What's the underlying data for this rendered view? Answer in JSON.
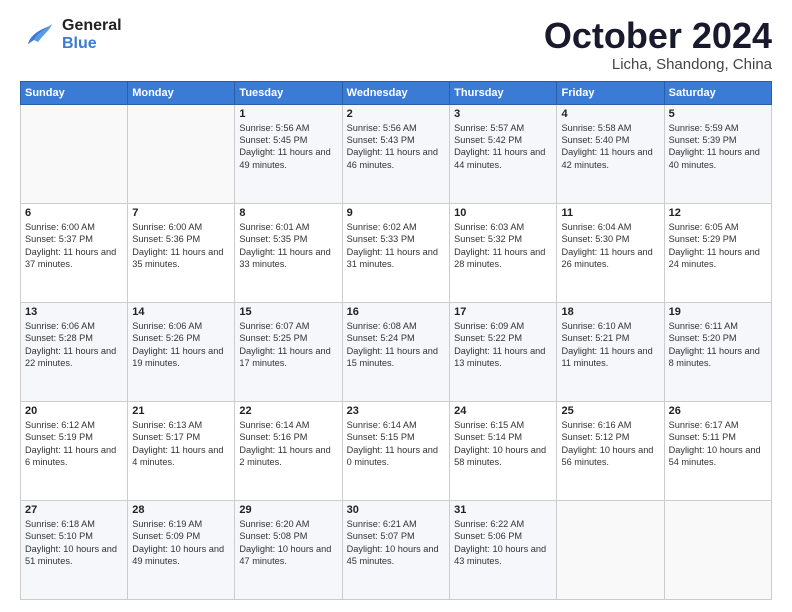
{
  "header": {
    "logo_general": "General",
    "logo_blue": "Blue",
    "month": "October 2024",
    "location": "Licha, Shandong, China"
  },
  "days_of_week": [
    "Sunday",
    "Monday",
    "Tuesday",
    "Wednesday",
    "Thursday",
    "Friday",
    "Saturday"
  ],
  "weeks": [
    [
      {
        "day": "",
        "info": ""
      },
      {
        "day": "",
        "info": ""
      },
      {
        "day": "1",
        "info": "Sunrise: 5:56 AM\nSunset: 5:45 PM\nDaylight: 11 hours and 49 minutes."
      },
      {
        "day": "2",
        "info": "Sunrise: 5:56 AM\nSunset: 5:43 PM\nDaylight: 11 hours and 46 minutes."
      },
      {
        "day": "3",
        "info": "Sunrise: 5:57 AM\nSunset: 5:42 PM\nDaylight: 11 hours and 44 minutes."
      },
      {
        "day": "4",
        "info": "Sunrise: 5:58 AM\nSunset: 5:40 PM\nDaylight: 11 hours and 42 minutes."
      },
      {
        "day": "5",
        "info": "Sunrise: 5:59 AM\nSunset: 5:39 PM\nDaylight: 11 hours and 40 minutes."
      }
    ],
    [
      {
        "day": "6",
        "info": "Sunrise: 6:00 AM\nSunset: 5:37 PM\nDaylight: 11 hours and 37 minutes."
      },
      {
        "day": "7",
        "info": "Sunrise: 6:00 AM\nSunset: 5:36 PM\nDaylight: 11 hours and 35 minutes."
      },
      {
        "day": "8",
        "info": "Sunrise: 6:01 AM\nSunset: 5:35 PM\nDaylight: 11 hours and 33 minutes."
      },
      {
        "day": "9",
        "info": "Sunrise: 6:02 AM\nSunset: 5:33 PM\nDaylight: 11 hours and 31 minutes."
      },
      {
        "day": "10",
        "info": "Sunrise: 6:03 AM\nSunset: 5:32 PM\nDaylight: 11 hours and 28 minutes."
      },
      {
        "day": "11",
        "info": "Sunrise: 6:04 AM\nSunset: 5:30 PM\nDaylight: 11 hours and 26 minutes."
      },
      {
        "day": "12",
        "info": "Sunrise: 6:05 AM\nSunset: 5:29 PM\nDaylight: 11 hours and 24 minutes."
      }
    ],
    [
      {
        "day": "13",
        "info": "Sunrise: 6:06 AM\nSunset: 5:28 PM\nDaylight: 11 hours and 22 minutes."
      },
      {
        "day": "14",
        "info": "Sunrise: 6:06 AM\nSunset: 5:26 PM\nDaylight: 11 hours and 19 minutes."
      },
      {
        "day": "15",
        "info": "Sunrise: 6:07 AM\nSunset: 5:25 PM\nDaylight: 11 hours and 17 minutes."
      },
      {
        "day": "16",
        "info": "Sunrise: 6:08 AM\nSunset: 5:24 PM\nDaylight: 11 hours and 15 minutes."
      },
      {
        "day": "17",
        "info": "Sunrise: 6:09 AM\nSunset: 5:22 PM\nDaylight: 11 hours and 13 minutes."
      },
      {
        "day": "18",
        "info": "Sunrise: 6:10 AM\nSunset: 5:21 PM\nDaylight: 11 hours and 11 minutes."
      },
      {
        "day": "19",
        "info": "Sunrise: 6:11 AM\nSunset: 5:20 PM\nDaylight: 11 hours and 8 minutes."
      }
    ],
    [
      {
        "day": "20",
        "info": "Sunrise: 6:12 AM\nSunset: 5:19 PM\nDaylight: 11 hours and 6 minutes."
      },
      {
        "day": "21",
        "info": "Sunrise: 6:13 AM\nSunset: 5:17 PM\nDaylight: 11 hours and 4 minutes."
      },
      {
        "day": "22",
        "info": "Sunrise: 6:14 AM\nSunset: 5:16 PM\nDaylight: 11 hours and 2 minutes."
      },
      {
        "day": "23",
        "info": "Sunrise: 6:14 AM\nSunset: 5:15 PM\nDaylight: 11 hours and 0 minutes."
      },
      {
        "day": "24",
        "info": "Sunrise: 6:15 AM\nSunset: 5:14 PM\nDaylight: 10 hours and 58 minutes."
      },
      {
        "day": "25",
        "info": "Sunrise: 6:16 AM\nSunset: 5:12 PM\nDaylight: 10 hours and 56 minutes."
      },
      {
        "day": "26",
        "info": "Sunrise: 6:17 AM\nSunset: 5:11 PM\nDaylight: 10 hours and 54 minutes."
      }
    ],
    [
      {
        "day": "27",
        "info": "Sunrise: 6:18 AM\nSunset: 5:10 PM\nDaylight: 10 hours and 51 minutes."
      },
      {
        "day": "28",
        "info": "Sunrise: 6:19 AM\nSunset: 5:09 PM\nDaylight: 10 hours and 49 minutes."
      },
      {
        "day": "29",
        "info": "Sunrise: 6:20 AM\nSunset: 5:08 PM\nDaylight: 10 hours and 47 minutes."
      },
      {
        "day": "30",
        "info": "Sunrise: 6:21 AM\nSunset: 5:07 PM\nDaylight: 10 hours and 45 minutes."
      },
      {
        "day": "31",
        "info": "Sunrise: 6:22 AM\nSunset: 5:06 PM\nDaylight: 10 hours and 43 minutes."
      },
      {
        "day": "",
        "info": ""
      },
      {
        "day": "",
        "info": ""
      }
    ]
  ]
}
